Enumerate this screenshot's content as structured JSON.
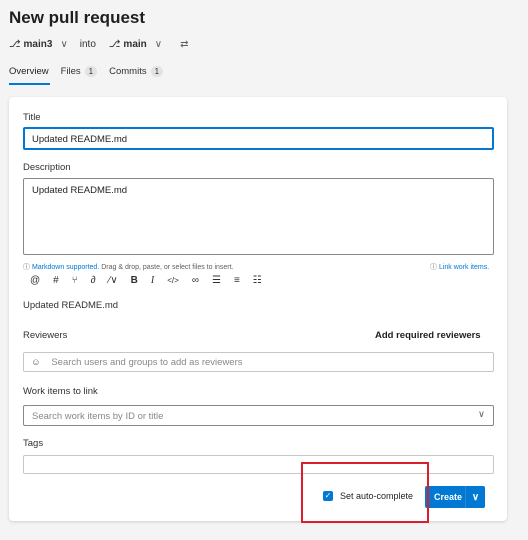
{
  "page": {
    "title": "New pull request"
  },
  "branches": {
    "source": "main3",
    "into": "into",
    "target": "main"
  },
  "tabs": [
    {
      "label": "Overview",
      "count": null
    },
    {
      "label": "Files",
      "count": "1"
    },
    {
      "label": "Commits",
      "count": "1"
    }
  ],
  "form": {
    "title_label": "Title",
    "title_value": "Updated README.md",
    "description_label": "Description",
    "description_value": "Updated README.md",
    "markdown_link": "Markdown supported.",
    "markdown_hint": "Drag & drop, paste, or select files to insert.",
    "link_work_items": "Link work items.",
    "preview_text": "Updated README.md",
    "reviewers_label": "Reviewers",
    "add_required_reviewers": "Add required reviewers",
    "reviewers_placeholder": "Search users and groups to add as reviewers",
    "work_items_label": "Work items to link",
    "work_items_placeholder": "Search work items by ID or title",
    "tags_label": "Tags",
    "auto_complete_label": "Set auto-complete",
    "auto_complete_checked": true,
    "create_label": "Create"
  },
  "toolbar_icons": [
    "mention-icon",
    "hashtag-icon",
    "pull-request-icon",
    "attach-icon",
    "format-icon",
    "bold-icon",
    "italic-icon",
    "code-icon",
    "link-icon",
    "bulleted-list-icon",
    "numbered-list-icon",
    "checklist-icon"
  ],
  "colors": {
    "accent": "#0078d4",
    "highlight": "#d9202a"
  }
}
